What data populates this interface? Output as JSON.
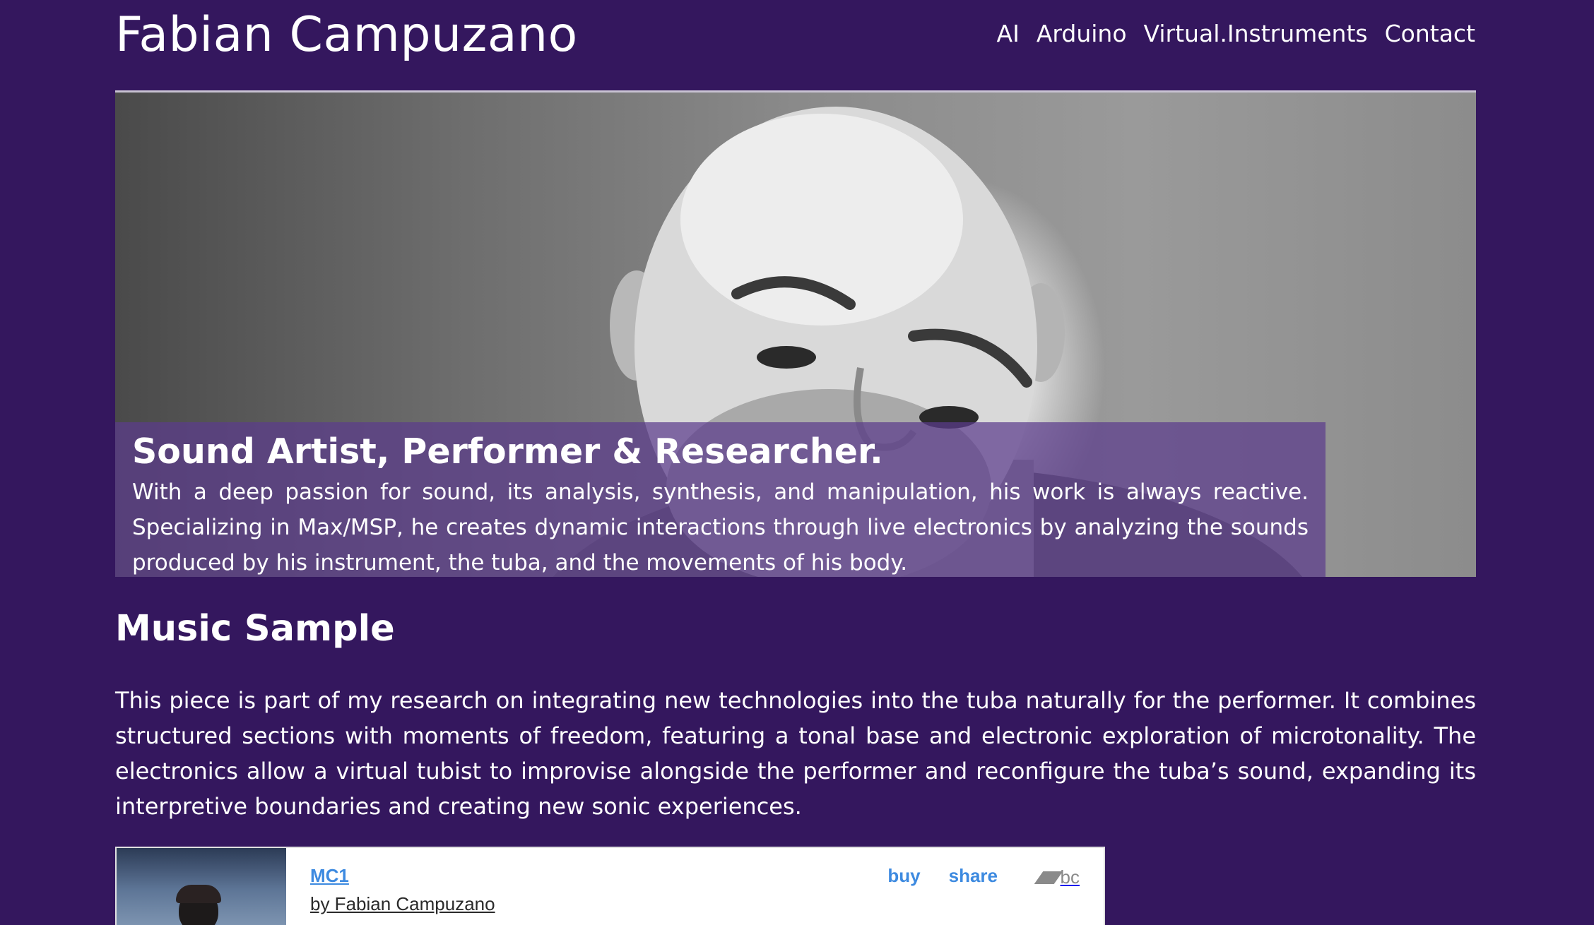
{
  "header": {
    "site_title": "Fabian Campuzano",
    "nav": [
      {
        "label": "AI"
      },
      {
        "label": "Arduino"
      },
      {
        "label": "Virtual.Instruments"
      },
      {
        "label": "Contact"
      }
    ]
  },
  "hero": {
    "heading": "Sound Artist, Performer & Researcher.",
    "text": "With a deep passion for sound, its analysis, synthesis, and manipulation, his work is always reactive. Specializing in Max/MSP, he creates dynamic interactions through live electronics by analyzing the sounds produced by his instrument, the tuba, and the movements of his body."
  },
  "music_sample": {
    "title": "Music Sample",
    "text": "This piece is part of my research on integrating new technologies into the tuba naturally for the performer. It combines structured sections with moments of freedom, featuring a tonal base and electronic exploration of microtonality. The electronics allow a virtual tubist to improvise alongside the performer and reconfigure the tuba’s sound, expanding its interpretive boundaries and creating new sonic experiences."
  },
  "player": {
    "track_title": "MC1",
    "artist": "by Fabian Campuzano",
    "buy_label": "buy",
    "share_label": "share",
    "logo_text": "bc"
  },
  "colors": {
    "background": "#34175e",
    "caption_overlay": "#5c3c8c",
    "link_blue": "#3d8ae0"
  }
}
